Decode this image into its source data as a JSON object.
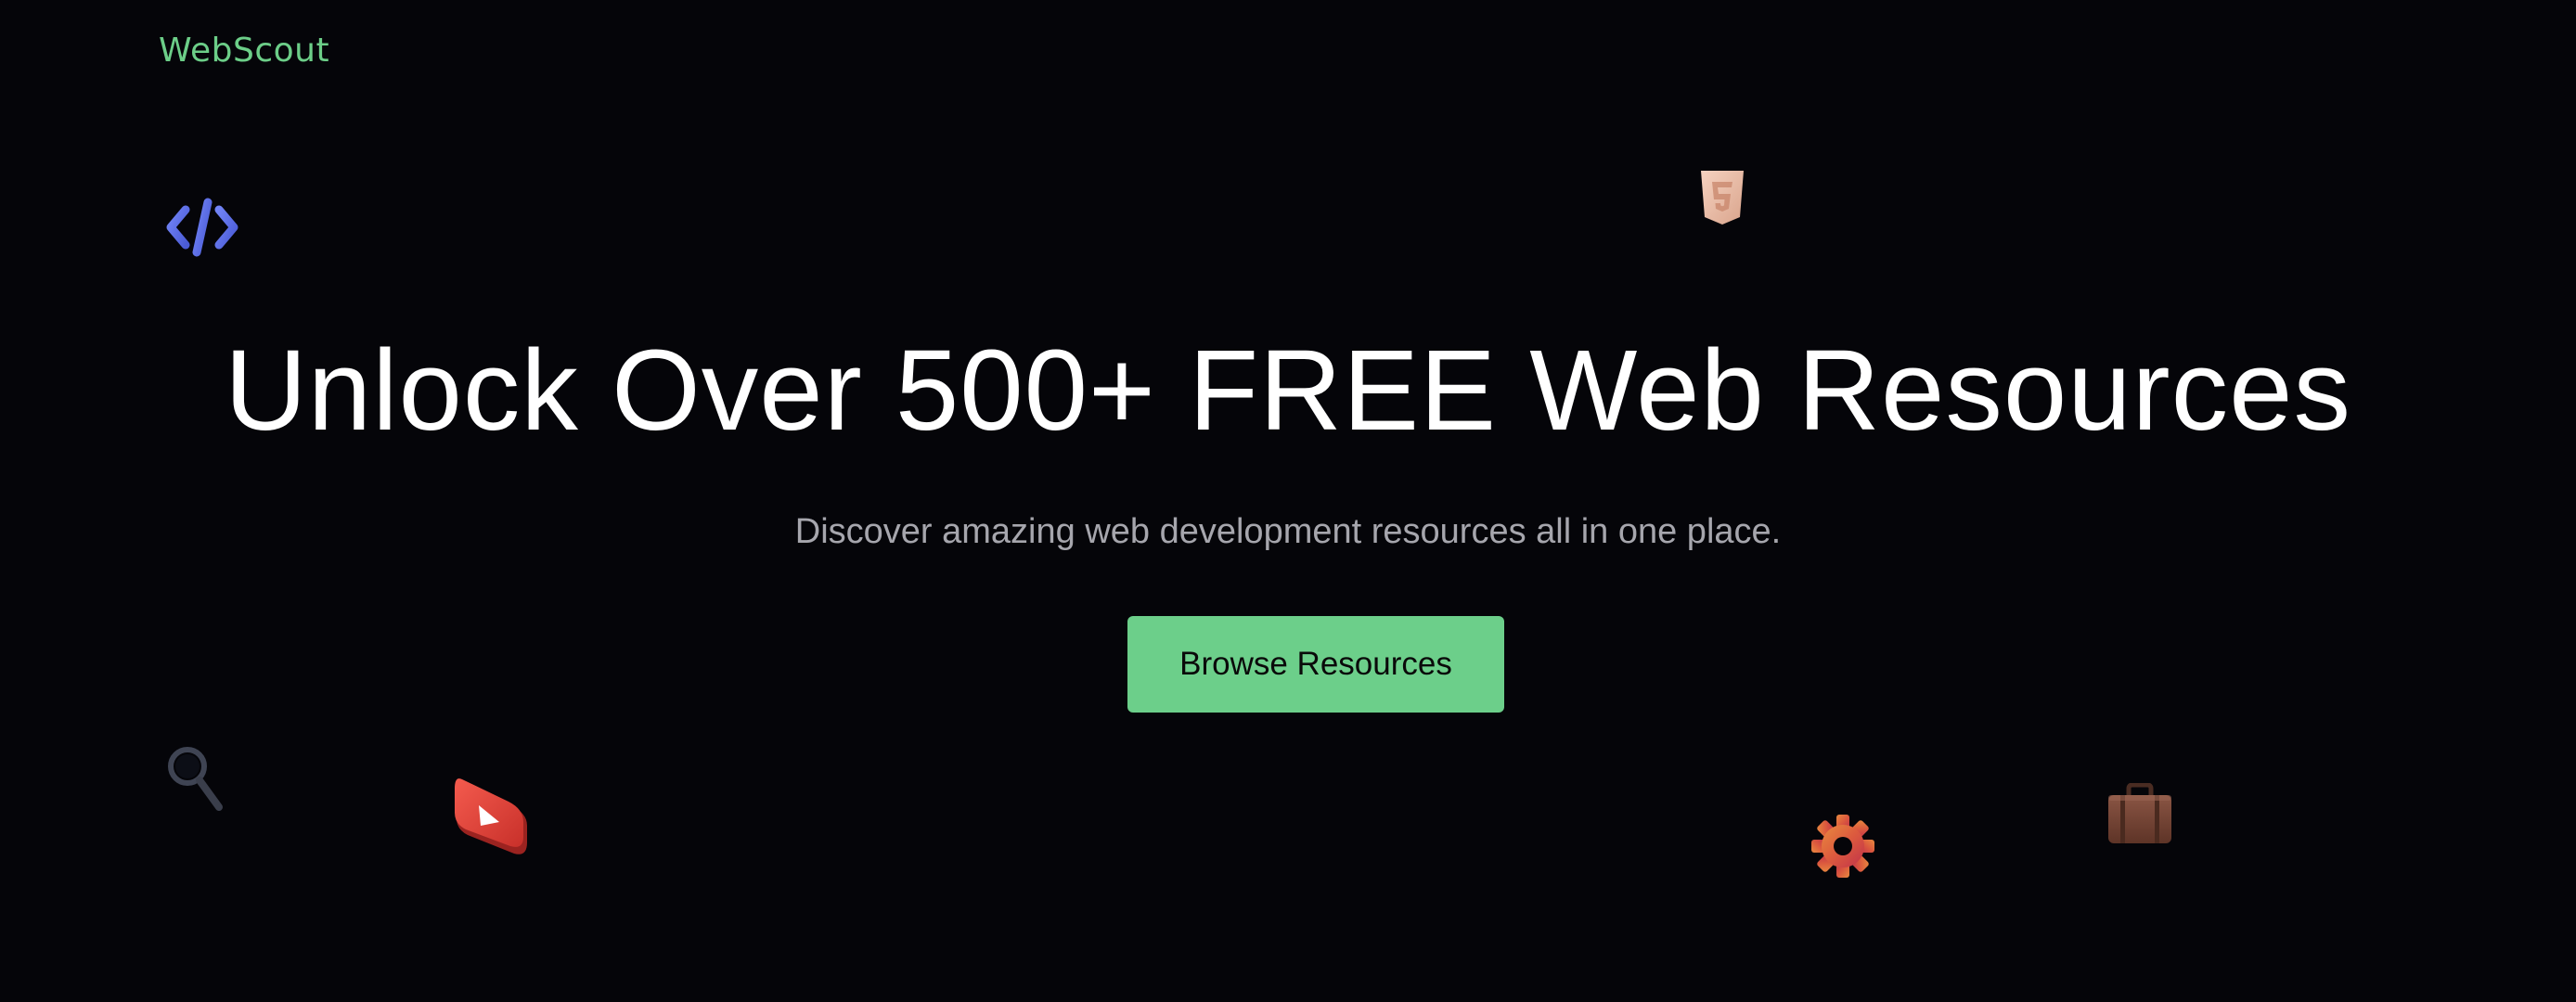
{
  "header": {
    "brand": "WebScout"
  },
  "hero": {
    "headline": "Unlock Over 500+ FREE Web Resources",
    "subtitle": "Discover amazing web development resources all in one place.",
    "cta_label": "Browse Resources"
  },
  "decorations": [
    {
      "icon": "code-icon",
      "color": "#5b6ee8"
    },
    {
      "icon": "html5-shield-icon",
      "color": "#e7b79f"
    },
    {
      "icon": "magnifier-icon",
      "color": "#3c4150"
    },
    {
      "icon": "play-button-icon",
      "color": "#e0443a"
    },
    {
      "icon": "gear-icon",
      "color": "#d4573d"
    },
    {
      "icon": "briefcase-icon",
      "color": "#7b4a3a"
    }
  ],
  "colors": {
    "background": "#050509",
    "accent": "#6ccf8a",
    "headline": "#ffffff",
    "subtitle": "#a6a6ad"
  }
}
